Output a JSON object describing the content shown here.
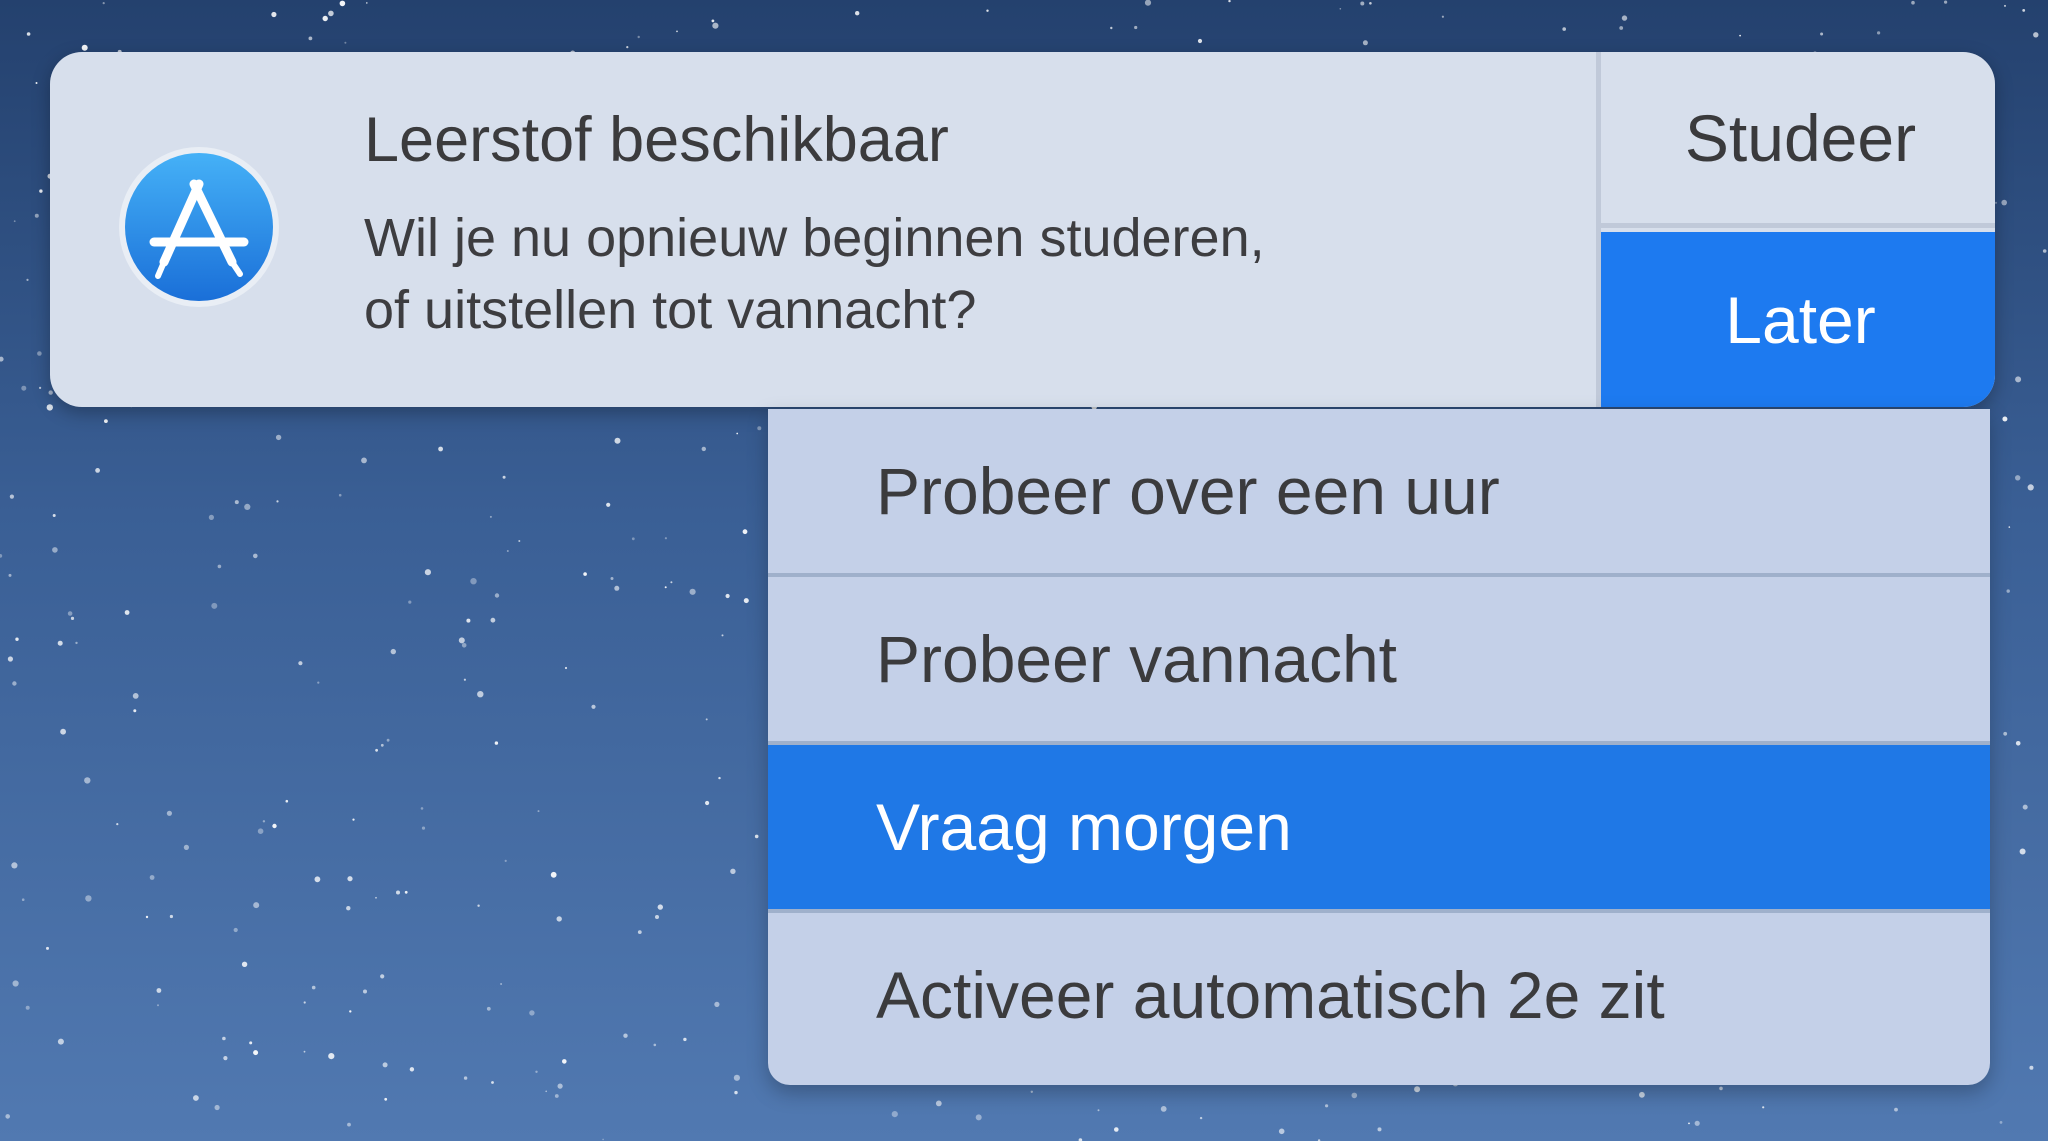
{
  "notification": {
    "app_icon": "app-store-icon",
    "title": "Leerstof beschikbaar",
    "message_line1": "Wil je nu opnieuw beginnen studeren,",
    "message_line2": "of uitstellen tot vannacht?",
    "actions": {
      "primary": "Studeer",
      "secondary": "Later"
    }
  },
  "later_menu": {
    "items": [
      {
        "label": "Probeer over een uur",
        "selected": false
      },
      {
        "label": "Probeer vannacht",
        "selected": false
      },
      {
        "label": "Vraag morgen",
        "selected": true
      },
      {
        "label": "Activeer automatisch 2e zit",
        "selected": false
      }
    ]
  },
  "colors": {
    "accent": "#1d7af0",
    "banner_bg": "#d7dfec",
    "menu_bg": "#c4d0e8",
    "text": "#3b3b3d"
  }
}
